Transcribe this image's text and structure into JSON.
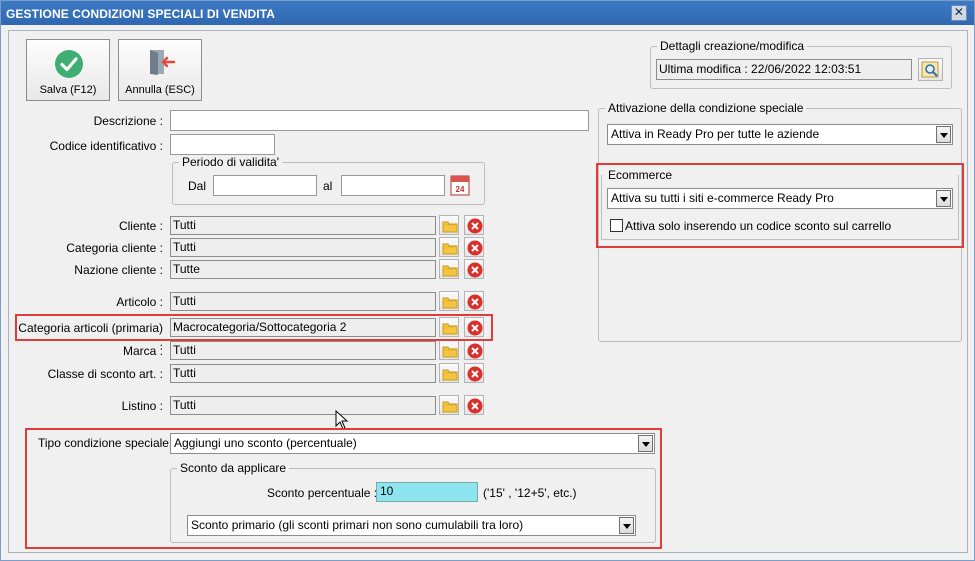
{
  "window": {
    "title": "GESTIONE CONDIZIONI SPECIALI DI VENDITA",
    "close_glyph": "✕"
  },
  "toolbar": {
    "save_label": "Salva (F12)",
    "cancel_label": "Annulla (ESC)"
  },
  "form": {
    "descrizione_label": "Descrizione :",
    "descrizione_value": "",
    "codice_label": "Codice identificativo :",
    "codice_value": "",
    "periodo": {
      "title": "Periodo di validita'",
      "dal_label": "Dal",
      "al_label": "al",
      "dal_value": "",
      "al_value": "",
      "calendar_day": "24"
    },
    "rows": [
      {
        "label": "Cliente :",
        "value": "Tutti"
      },
      {
        "label": "Categoria cliente :",
        "value": "Tutti"
      },
      {
        "label": "Nazione cliente :",
        "value": "Tutte"
      },
      {
        "label": "Articolo :",
        "value": "Tutti"
      },
      {
        "label": "Categoria articoli (primaria) :",
        "value": "Macrocategoria/Sottocategoria 2"
      },
      {
        "label": "Marca :",
        "value": "Tutti"
      },
      {
        "label": "Classe di sconto art. :",
        "value": "Tutti"
      },
      {
        "label": "Listino :",
        "value": "Tutti"
      }
    ],
    "tipo_label": "Tipo condizione speciale :",
    "tipo_value": "Aggiungi uno sconto (percentuale)",
    "sconto": {
      "title": "Sconto da applicare",
      "percent_label": "Sconto percentuale :",
      "percent_value": "10",
      "hint": "('15' , '12+5', etc.)",
      "type_value": "Sconto primario (gli sconti primari non sono cumulabili tra loro)"
    }
  },
  "details": {
    "title": "Dettagli creazione/modifica",
    "value": "Ultima modifica : 22/06/2022  12:03:51"
  },
  "activation": {
    "title": "Attivazione della condizione speciale",
    "value": "Attiva in Ready Pro per tutte le aziende"
  },
  "ecommerce": {
    "title": "Ecommerce",
    "value": "Attiva su tutti i siti e-commerce Ready Pro",
    "checkbox_label": "Attiva solo inserendo un codice sconto sul carrello",
    "checked": false
  },
  "colors": {
    "titlebar": "#2f68b0",
    "highlight": "#e03c3c",
    "save_green": "#3fae73",
    "cancel_red": "#e0493a"
  }
}
